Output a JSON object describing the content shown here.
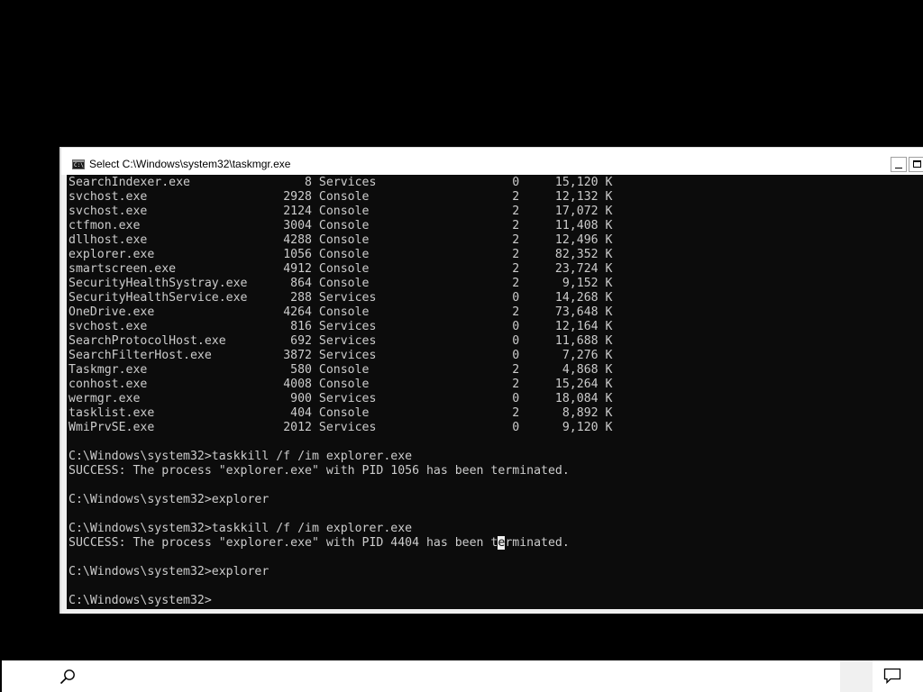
{
  "window": {
    "title": "Select C:\\Windows\\system32\\taskmgr.exe",
    "icon": "console-app-icon",
    "icon_glyph": "C:\\"
  },
  "console": {
    "process_rows": [
      {
        "image": "SearchIndexer.exe",
        "pid": "8",
        "session": "Services",
        "session_num": "0",
        "mem": "15,120 K"
      },
      {
        "image": "svchost.exe",
        "pid": "2928",
        "session": "Console",
        "session_num": "2",
        "mem": "12,132 K"
      },
      {
        "image": "svchost.exe",
        "pid": "2124",
        "session": "Console",
        "session_num": "2",
        "mem": "17,072 K"
      },
      {
        "image": "ctfmon.exe",
        "pid": "3004",
        "session": "Console",
        "session_num": "2",
        "mem": "11,408 K"
      },
      {
        "image": "dllhost.exe",
        "pid": "4288",
        "session": "Console",
        "session_num": "2",
        "mem": "12,496 K"
      },
      {
        "image": "explorer.exe",
        "pid": "1056",
        "session": "Console",
        "session_num": "2",
        "mem": "82,352 K"
      },
      {
        "image": "smartscreen.exe",
        "pid": "4912",
        "session": "Console",
        "session_num": "2",
        "mem": "23,724 K"
      },
      {
        "image": "SecurityHealthSystray.exe",
        "pid": "864",
        "session": "Console",
        "session_num": "2",
        "mem": "9,152 K"
      },
      {
        "image": "SecurityHealthService.exe",
        "pid": "288",
        "session": "Services",
        "session_num": "0",
        "mem": "14,268 K"
      },
      {
        "image": "OneDrive.exe",
        "pid": "4264",
        "session": "Console",
        "session_num": "2",
        "mem": "73,648 K"
      },
      {
        "image": "svchost.exe",
        "pid": "816",
        "session": "Services",
        "session_num": "0",
        "mem": "12,164 K"
      },
      {
        "image": "SearchProtocolHost.exe",
        "pid": "692",
        "session": "Services",
        "session_num": "0",
        "mem": "11,688 K"
      },
      {
        "image": "SearchFilterHost.exe",
        "pid": "3872",
        "session": "Services",
        "session_num": "0",
        "mem": "7,276 K"
      },
      {
        "image": "Taskmgr.exe",
        "pid": "580",
        "session": "Console",
        "session_num": "2",
        "mem": "4,868 K"
      },
      {
        "image": "conhost.exe",
        "pid": "4008",
        "session": "Console",
        "session_num": "2",
        "mem": "15,264 K"
      },
      {
        "image": "wermgr.exe",
        "pid": "900",
        "session": "Services",
        "session_num": "0",
        "mem": "18,084 K"
      },
      {
        "image": "tasklist.exe",
        "pid": "404",
        "session": "Console",
        "session_num": "2",
        "mem": "8,892 K"
      },
      {
        "image": "WmiPrvSE.exe",
        "pid": "2012",
        "session": "Services",
        "session_num": "0",
        "mem": "9,120 K"
      }
    ],
    "lines_after": [
      "",
      "C:\\Windows\\system32>taskkill /f /im explorer.exe",
      "SUCCESS: The process \"explorer.exe\" with PID 1056 has been terminated.",
      "",
      "C:\\Windows\\system32>explorer",
      "",
      "C:\\Windows\\system32>taskkill /f /im explorer.exe",
      "SUCCESS: The process \"explorer.exe\" with PID 4404 has been terminated.",
      "",
      "C:\\Windows\\system32>explorer",
      "",
      "C:\\Windows\\system32>"
    ],
    "selection_cursor": {
      "line_index": 7,
      "char_index": 60
    },
    "colors": {
      "background": "#0c0c0c",
      "text": "#cccccc",
      "selection": "#f0f0f0"
    }
  },
  "taskbar": {
    "search_icon": "search-icon",
    "notification_icon": "action-center-icon",
    "background": "#ffffff"
  }
}
